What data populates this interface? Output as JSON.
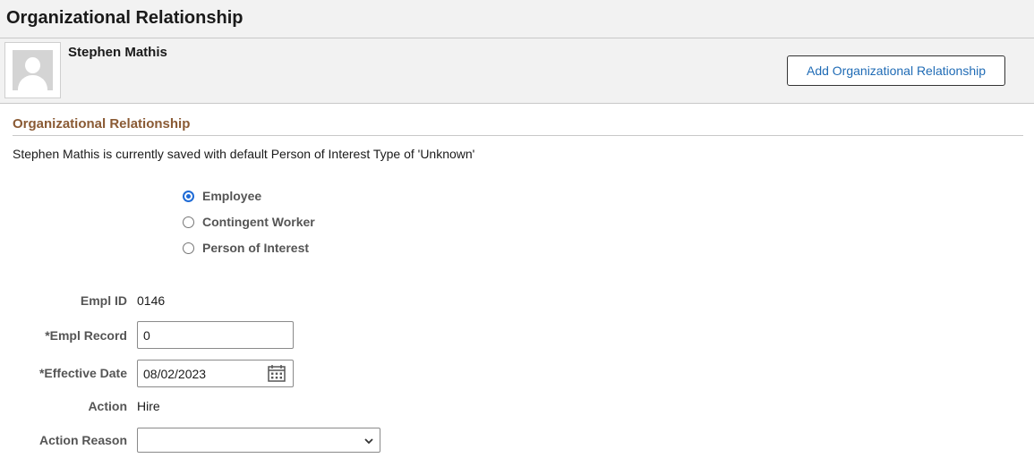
{
  "page": {
    "title": "Organizational Relationship"
  },
  "person": {
    "name": "Stephen Mathis",
    "avatar_icon": "person-silhouette-icon"
  },
  "actions": {
    "add_label": "Add Organizational Relationship"
  },
  "section": {
    "title": "Organizational Relationship",
    "info": "Stephen Mathis is currently saved with default Person of Interest Type of 'Unknown'"
  },
  "relationship": {
    "selected": "Employee",
    "options": [
      "Employee",
      "Contingent Worker",
      "Person of Interest"
    ]
  },
  "form": {
    "empl_id_label": "Empl ID",
    "empl_id_value": "0146",
    "empl_record_label": "*Empl Record",
    "empl_record_value": "0",
    "effective_date_label": "*Effective Date",
    "effective_date_value": "08/02/2023",
    "action_label": "Action",
    "action_value": "Hire",
    "action_reason_label": "Action Reason",
    "action_reason_value": ""
  },
  "colors": {
    "section_title": "#8a5a34",
    "button_text": "#1f6bb5",
    "radio_selected": "#1f6bd6",
    "header_bg": "#f2f2f2"
  }
}
